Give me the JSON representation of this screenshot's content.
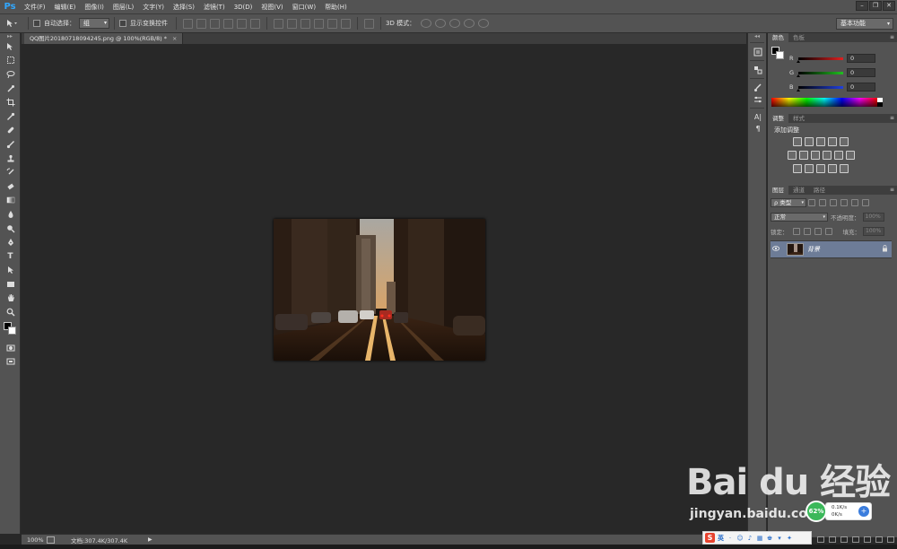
{
  "app": {
    "logo": "Ps"
  },
  "menu": [
    "文件(F)",
    "编辑(E)",
    "图像(I)",
    "图层(L)",
    "文字(Y)",
    "选择(S)",
    "滤镜(T)",
    "3D(D)",
    "视图(V)",
    "窗口(W)",
    "帮助(H)"
  ],
  "window_controls": {
    "minimize": "–",
    "restore": "❐",
    "close": "✕"
  },
  "options": {
    "auto_select_label": "自动选择：",
    "auto_select_value": "组",
    "show_transform_label": "显示变换控件",
    "mode3d_label": "3D 模式：",
    "workspace": "基本功能"
  },
  "document": {
    "tab_title": "QQ图片20180718094245.png @ 100%(RGB/8) *",
    "tab_close": "×"
  },
  "panels": {
    "color": {
      "tabs": [
        "颜色",
        "色板"
      ],
      "channels": [
        {
          "label": "R",
          "value": "0",
          "color": "#e02020"
        },
        {
          "label": "G",
          "value": "0",
          "color": "#20c020"
        },
        {
          "label": "B",
          "value": "0",
          "color": "#2040e0"
        }
      ]
    },
    "adjustments": {
      "tabs": [
        "调整",
        "样式"
      ],
      "title": "添加调整"
    },
    "layers": {
      "tabs": [
        "图层",
        "通道",
        "路径"
      ],
      "filter_label": "ρ 类型",
      "blend_mode": "正常",
      "opacity_label": "不透明度：",
      "opacity_value": "100%",
      "lock_label": "锁定：",
      "fill_label": "填充：",
      "fill_value": "100%",
      "layer_name": "背景",
      "layer_visible_icon": "👁"
    },
    "menu_icon": "≡"
  },
  "status": {
    "zoom": "100%",
    "doc_size": "文档:307.4K/307.4K",
    "arrow": "▶"
  },
  "ime": {
    "logo": "S",
    "lang": "英"
  },
  "network": {
    "percent": "62%",
    "upload": "0.1K/s",
    "download": "0K/s",
    "button": "+"
  },
  "watermark": {
    "main": "Bai du 经验",
    "sub": "jingyan.baidu.com"
  },
  "colors": {
    "accent": "#31a8ff",
    "panel_bg": "#535353",
    "canvas_bg": "#282828",
    "layer_selected": "#6d7c97"
  }
}
